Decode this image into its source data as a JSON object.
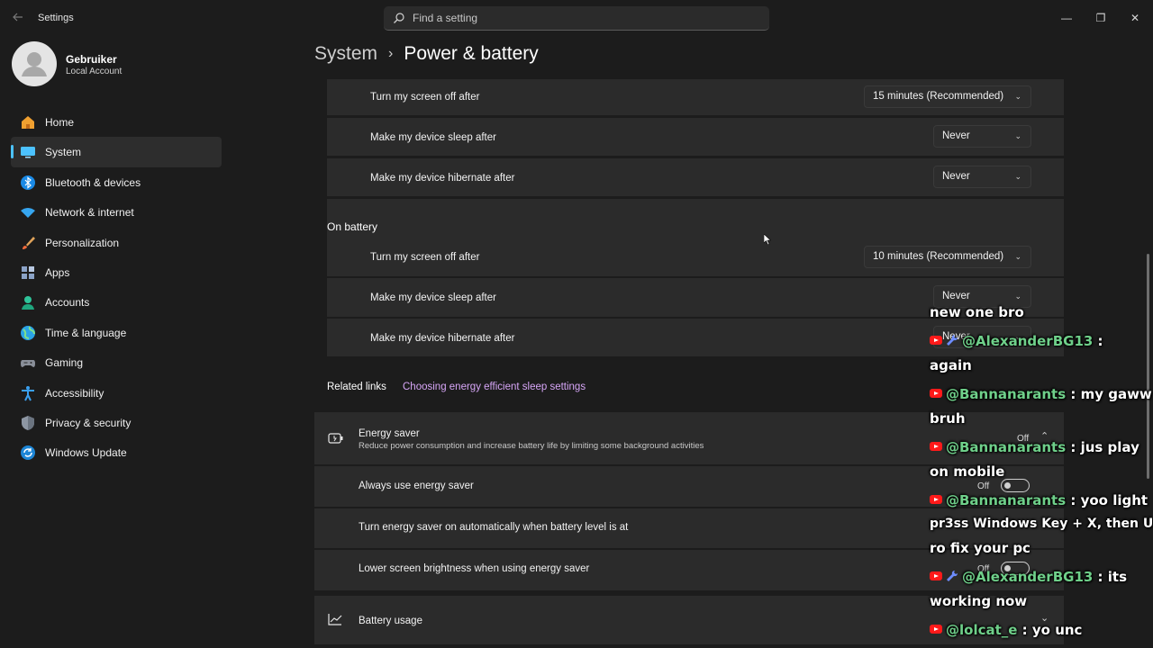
{
  "window": {
    "app_title": "Settings",
    "minimize": "—",
    "maximize": "❐",
    "close": "✕"
  },
  "search": {
    "placeholder": "Find a setting"
  },
  "profile": {
    "name": "Gebruiker",
    "account_type": "Local Account"
  },
  "sidebar": {
    "items": [
      {
        "label": "Home",
        "icon": "home-icon"
      },
      {
        "label": "System",
        "icon": "system-icon",
        "active": true
      },
      {
        "label": "Bluetooth & devices",
        "icon": "bluetooth-icon"
      },
      {
        "label": "Network & internet",
        "icon": "wifi-icon"
      },
      {
        "label": "Personalization",
        "icon": "brush-icon"
      },
      {
        "label": "Apps",
        "icon": "apps-icon"
      },
      {
        "label": "Accounts",
        "icon": "accounts-icon"
      },
      {
        "label": "Time & language",
        "icon": "globe-icon"
      },
      {
        "label": "Gaming",
        "icon": "gamepad-icon"
      },
      {
        "label": "Accessibility",
        "icon": "accessibility-icon"
      },
      {
        "label": "Privacy & security",
        "icon": "shield-icon"
      },
      {
        "label": "Windows Update",
        "icon": "update-icon"
      }
    ]
  },
  "header": {
    "parent": "System",
    "separator": "›",
    "current": "Power & battery"
  },
  "plugged_in": {
    "rows": [
      {
        "label": "Turn my screen off after",
        "value": "15 minutes (Recommended)"
      },
      {
        "label": "Make my device sleep after",
        "value": "Never"
      },
      {
        "label": "Make my device hibernate after",
        "value": "Never"
      }
    ]
  },
  "on_battery": {
    "heading": "On battery",
    "rows": [
      {
        "label": "Turn my screen off after",
        "value": "10 minutes (Recommended)"
      },
      {
        "label": "Make my device sleep after",
        "value": "Never"
      },
      {
        "label": "Make my device hibernate after",
        "value": "Never"
      }
    ]
  },
  "related": {
    "heading": "Related links",
    "link": "Choosing energy efficient sleep settings"
  },
  "energy_saver": {
    "title": "Energy saver",
    "description": "Reduce power consumption and increase battery life by limiting some background activities",
    "status": "Off",
    "rows": [
      {
        "label": "Always use energy saver",
        "state": "Off"
      },
      {
        "label": "Turn energy saver on automatically when battery level is at"
      },
      {
        "label": "Lower screen brightness when using energy saver",
        "state": "Off"
      }
    ]
  },
  "battery_usage": {
    "title": "Battery usage"
  },
  "chat": {
    "lines": [
      {
        "text": "new one bro"
      },
      {
        "user": "@AlexanderBG13",
        "msg": " :"
      },
      {
        "text": "again"
      },
      {
        "user": "@Bannanarants",
        "msg": " : my gaww"
      },
      {
        "text": "bruh"
      },
      {
        "user": "@Bannanarants",
        "msg": " : jus play"
      },
      {
        "text": "on mobile"
      },
      {
        "user": "@Bannanarants",
        "msg": " : yoo light"
      },
      {
        "text": "pr3ss Windows Key + X, then U"
      },
      {
        "text": "ro fix your pc"
      },
      {
        "user": "@AlexanderBG13",
        "msg": " : its"
      },
      {
        "text": "working now"
      },
      {
        "user": "@lolcat_e",
        "msg": " : yo unc"
      }
    ]
  },
  "colors": {
    "background": "#1c1c1c",
    "card": "#2b2b2b",
    "accent": "#4cc2ff",
    "link": "#d7a6f7",
    "chat_user": "#6fd08a"
  }
}
